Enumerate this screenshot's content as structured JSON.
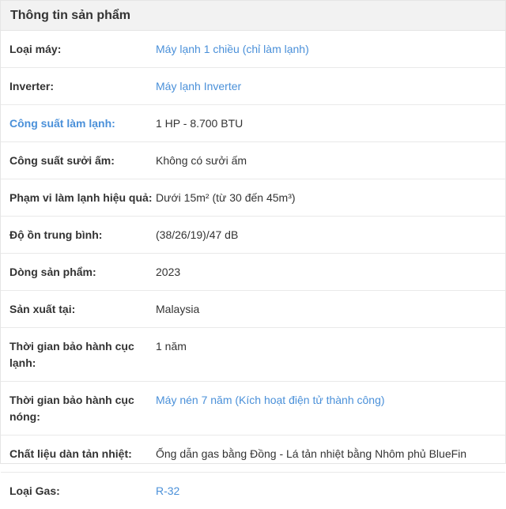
{
  "header": {
    "title": "Thông tin sản phẩm"
  },
  "specs": [
    {
      "label": "Loại máy:",
      "value": "Máy lạnh 1 chiều (chỉ làm lạnh)",
      "label_link": false,
      "value_link": true
    },
    {
      "label": "Inverter:",
      "value": "Máy lạnh Inverter",
      "label_link": false,
      "value_link": true
    },
    {
      "label": "Công suất làm lạnh:",
      "value": "1 HP - 8.700 BTU",
      "label_link": true,
      "value_link": false
    },
    {
      "label": "Công suất sưởi ấm:",
      "value": "Không có sưởi ấm",
      "label_link": false,
      "value_link": false
    },
    {
      "label": "Phạm vi làm lạnh hiệu quả:",
      "value": "Dưới 15m² (từ 30 đến 45m³)",
      "label_link": false,
      "value_link": false
    },
    {
      "label": "Độ ồn trung bình:",
      "value": "(38/26/19)/47 dB",
      "label_link": false,
      "value_link": false
    },
    {
      "label": "Dòng sản phẩm:",
      "value": "2023",
      "label_link": false,
      "value_link": false
    },
    {
      "label": "Sản xuất tại:",
      "value": "Malaysia",
      "label_link": false,
      "value_link": false
    },
    {
      "label": "Thời gian bảo hành cục lạnh:",
      "value": "1 năm",
      "label_link": false,
      "value_link": false
    },
    {
      "label": "Thời gian bảo hành cục nóng:",
      "value": "Máy nén 7 năm (Kích hoạt điện tử thành công)",
      "label_link": false,
      "value_link": true
    },
    {
      "label": "Chất liệu dàn tản nhiệt:",
      "value": "Ống dẫn gas bằng Đồng - Lá tản nhiệt bằng Nhôm phủ BlueFin",
      "label_link": false,
      "value_link": false
    },
    {
      "label": "Loại Gas:",
      "value": "R-32",
      "label_link": false,
      "value_link": true
    }
  ],
  "colors": {
    "link": "#4a90d9",
    "text": "#333333",
    "header_bg": "#f2f2f2",
    "border": "#e9e9e9"
  }
}
